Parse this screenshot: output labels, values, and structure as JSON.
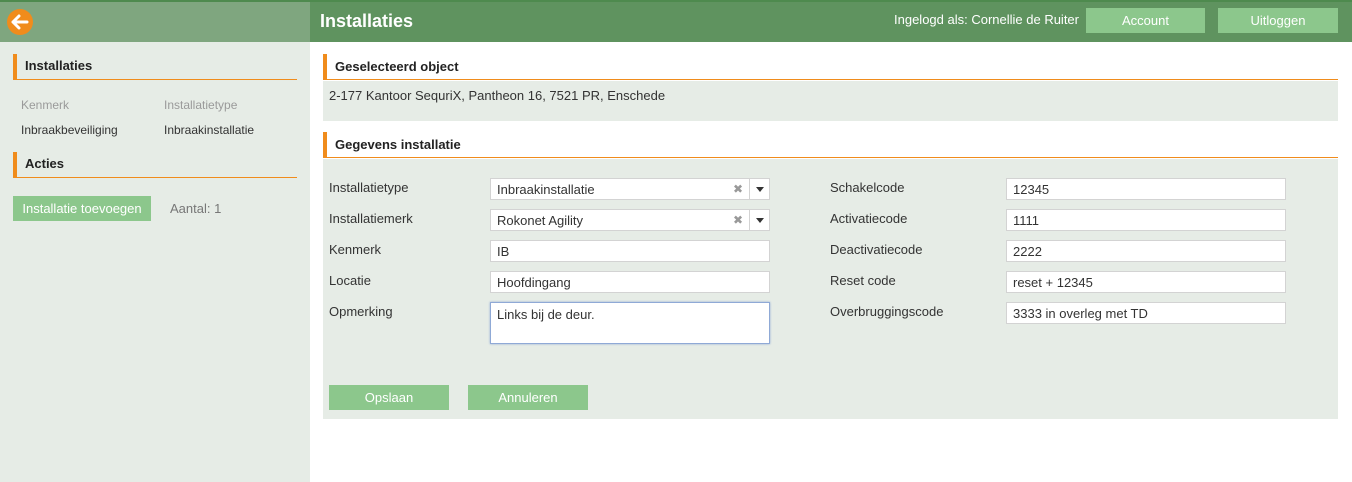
{
  "header": {
    "title": "Installaties",
    "login_label": "Ingelogd als: Cornellie de Ruiter",
    "account_label": "Account",
    "logout_label": "Uitloggen"
  },
  "sidebar": {
    "installaties_heading": "Installaties",
    "col_kenmerk": "Kenmerk",
    "col_installatietype": "Installatietype",
    "row_kenmerk": "Inbraakbeveiliging",
    "row_installatietype": "Inbraakinstallatie",
    "acties_heading": "Acties",
    "add_button": "Installatie toevoegen",
    "count_label": "Aantal: 1"
  },
  "selected": {
    "heading": "Geselecteerd object",
    "text": "2-177 Kantoor SequriX, Pantheon 16, 7521 PR, Enschede"
  },
  "form": {
    "heading": "Gegevens installatie",
    "installatietype_label": "Installatietype",
    "installatietype_value": "Inbraakinstallatie",
    "installatiemerk_label": "Installatiemerk",
    "installatiemerk_value": "Rokonet Agility",
    "kenmerk_label": "Kenmerk",
    "kenmerk_value": "IB",
    "locatie_label": "Locatie",
    "locatie_value": "Hoofdingang",
    "opmerking_label": "Opmerking",
    "opmerking_value": "Links bij de deur.",
    "schakelcode_label": "Schakelcode",
    "schakelcode_value": "12345",
    "activatiecode_label": "Activatiecode",
    "activatiecode_value": "1111",
    "deactivatiecode_label": "Deactivatiecode",
    "deactivatiecode_value": "2222",
    "resetcode_label": "Reset code",
    "resetcode_value": "reset + 12345",
    "overbrugging_label": "Overbruggingscode",
    "overbrugging_value": "3333 in overleg met TD",
    "save_label": "Opslaan",
    "cancel_label": "Annuleren"
  },
  "colors": {
    "header_green": "#5f935f",
    "button_green": "#8cc78c",
    "accent_orange": "#f08c1c",
    "panel_bg": "#e6ece6"
  },
  "icons": {
    "back": "arrow-left-icon",
    "clear": "clear-x-icon",
    "dropdown": "chevron-down-icon"
  }
}
